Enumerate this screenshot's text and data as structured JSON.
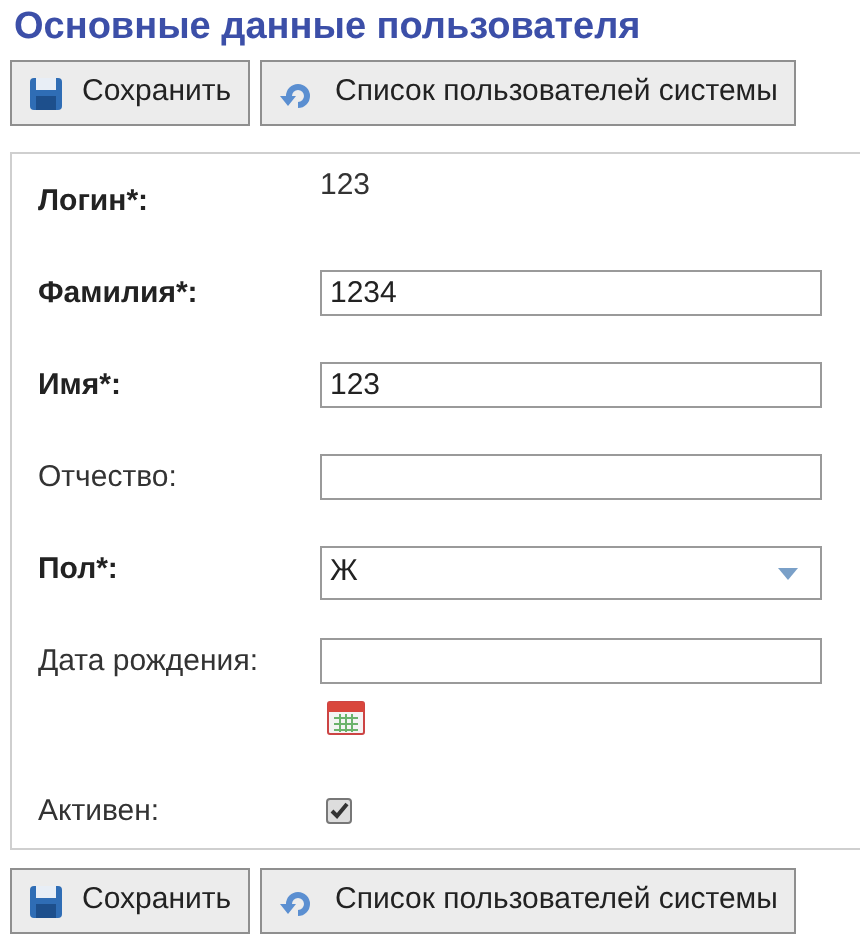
{
  "title": "Основные данные пользователя",
  "toolbar_top": [
    {
      "kind": "save",
      "label": "Сохранить"
    },
    {
      "kind": "list",
      "label": "Список пользователей системы"
    }
  ],
  "fields": [
    {
      "kind": "text",
      "label": "Логин*:",
      "bold": true,
      "value": "123"
    },
    {
      "kind": "input",
      "label": "Фамилия*:",
      "bold": true,
      "value": "1234"
    },
    {
      "kind": "input",
      "label": "Имя*:",
      "bold": true,
      "value": "123"
    },
    {
      "kind": "input",
      "label": "Отчество:",
      "bold": false
    },
    {
      "kind": "select",
      "label": "Пол*:",
      "bold": true,
      "value": "Ж"
    },
    {
      "kind": "date",
      "label": "Дата рождения:",
      "bold": false
    },
    {
      "kind": "checkbox",
      "label": "Активен:",
      "bold": false,
      "checked": true
    }
  ],
  "toolbar_bottom": [
    {
      "kind": "save",
      "label": "Сохранить"
    },
    {
      "kind": "list",
      "label": "Список пользователей системы"
    }
  ]
}
